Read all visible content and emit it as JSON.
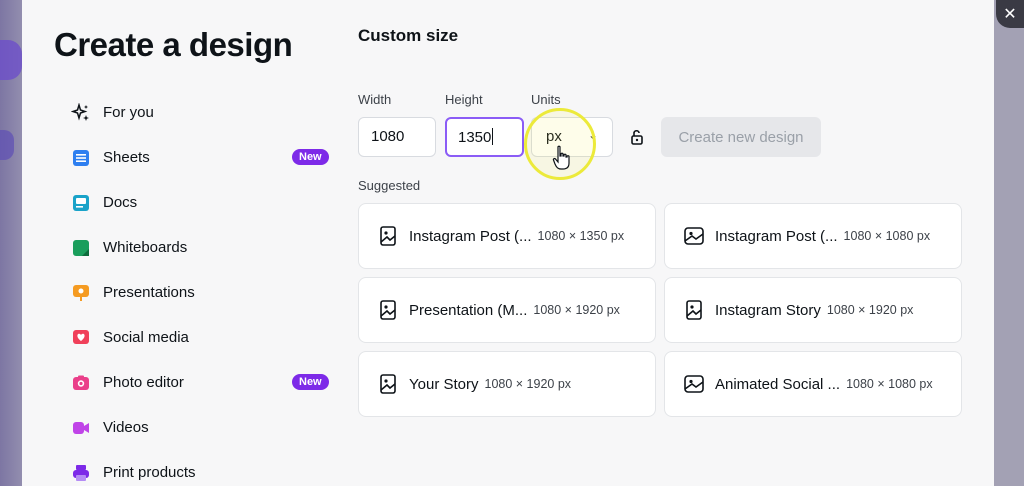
{
  "modal": {
    "title": "Create a design",
    "close_glyph": "✕"
  },
  "nav": [
    {
      "label": "For you",
      "icon": "sparkle-icon",
      "badge": ""
    },
    {
      "label": "Sheets",
      "icon": "sheets-icon",
      "badge": "New",
      "color": "#2e7ff0"
    },
    {
      "label": "Docs",
      "icon": "docs-icon",
      "badge": "",
      "color": "#1aa3c9"
    },
    {
      "label": "Whiteboards",
      "icon": "whiteboard-icon",
      "badge": "",
      "color": "#1a9e5c"
    },
    {
      "label": "Presentations",
      "icon": "presentation-icon",
      "badge": "",
      "color": "#f59b22"
    },
    {
      "label": "Social media",
      "icon": "heart-icon",
      "badge": "",
      "color": "#f0405a"
    },
    {
      "label": "Photo editor",
      "icon": "camera-icon",
      "badge": "New",
      "color": "#ea3f8a"
    },
    {
      "label": "Videos",
      "icon": "video-icon",
      "badge": "",
      "color": "#c044e8"
    },
    {
      "label": "Print products",
      "icon": "print-icon",
      "badge": "",
      "color": "#7d2ae8"
    }
  ],
  "custom": {
    "title": "Custom size",
    "width_label": "Width",
    "width_value": "1080",
    "height_label": "Height",
    "height_value": "1350",
    "units_label": "Units",
    "units_value": "px",
    "create_label": "Create new design",
    "suggested_label": "Suggested"
  },
  "suggested": [
    {
      "name": "Instagram Post (...",
      "dims": "1080 × 1350 px",
      "icon": "portrait-image-icon"
    },
    {
      "name": "Instagram Post (...",
      "dims": "1080 × 1080 px",
      "icon": "image-icon"
    },
    {
      "name": "Presentation (M...",
      "dims": "1080 × 1920 px",
      "icon": "portrait-image-icon"
    },
    {
      "name": "Instagram Story",
      "dims": "1080 × 1920 px",
      "icon": "portrait-image-icon"
    },
    {
      "name": "Your Story",
      "dims": "1080 × 1920 px",
      "icon": "portrait-image-icon"
    },
    {
      "name": "Animated Social ...",
      "dims": "1080 × 1080 px",
      "icon": "image-icon"
    }
  ]
}
